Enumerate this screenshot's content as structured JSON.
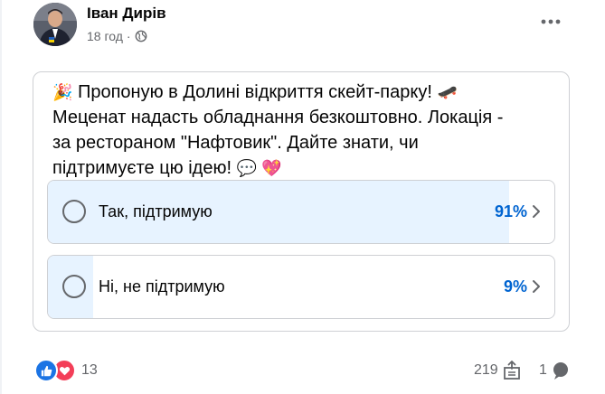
{
  "post": {
    "author": "Іван Дирів",
    "time": "18 год",
    "separator": "·",
    "privacy_icon": "globe-icon",
    "more_icon": "more-icon"
  },
  "poll": {
    "question_prefix_emoji": "🎉",
    "question_line1": "Пропоную в Долині відкриття скейт-парку!",
    "question_line1_emoji": "🛹",
    "question_line2": "Меценат надасть обладнання безкоштовно. Локація -",
    "question_line3": "за рестораном \"Нафтовик\". Дайте знати, чи",
    "question_line4": "підтримуєте цю ідею!",
    "question_line4_emojis": "💬 💖",
    "options": [
      {
        "label": "Так, підтримую",
        "percent": "91%",
        "fraction": 0.91
      },
      {
        "label": "Ні, не підтримую",
        "percent": "9%",
        "fraction": 0.09
      }
    ],
    "accent_color": "#0064d1",
    "fill_color": "#e7f3ff"
  },
  "footer": {
    "reaction_icons": [
      "like-icon",
      "love-icon"
    ],
    "reactions_count": "13",
    "shares_count": "219",
    "comments_count": "1"
  }
}
